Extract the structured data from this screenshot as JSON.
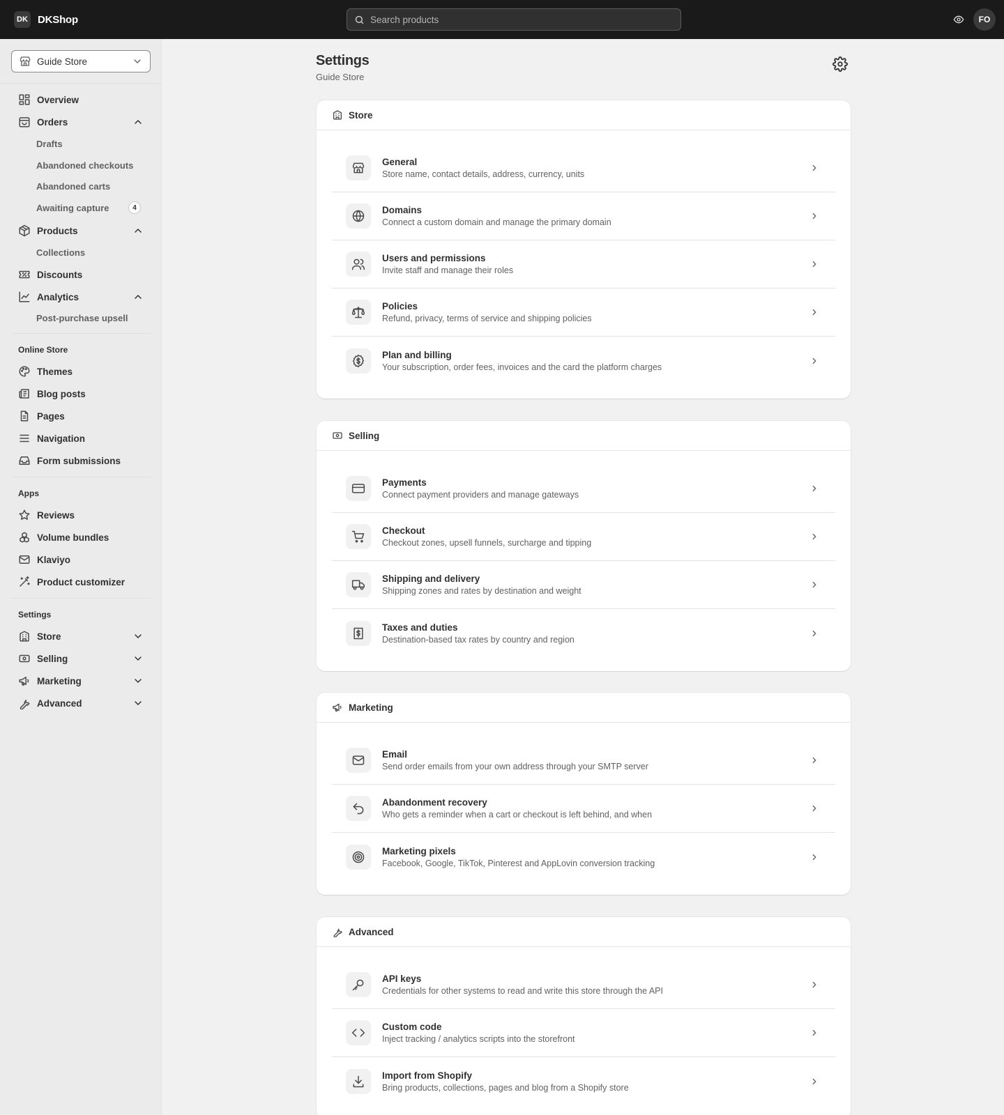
{
  "app": {
    "badge": "DK",
    "name": "DKShop"
  },
  "search": {
    "placeholder": "Search products"
  },
  "user": {
    "initials": "FO"
  },
  "sidebar": {
    "store_selector": "Guide Store",
    "main_nav": [
      {
        "label": "Overview",
        "icon": "overview-grid-icon"
      },
      {
        "label": "Orders",
        "icon": "orders-bag-icon",
        "expanded": true
      },
      {
        "label": "Drafts"
      },
      {
        "label": "Abandoned checkouts"
      },
      {
        "label": "Abandoned carts"
      },
      {
        "label": "Awaiting capture",
        "badge": "4"
      },
      {
        "label": "Products",
        "icon": "products-box-icon",
        "expanded": true
      },
      {
        "label": "Collections"
      },
      {
        "label": "Discounts",
        "icon": "discount-ticket-icon"
      },
      {
        "label": "Analytics",
        "icon": "analytics-chart-icon",
        "expanded": true
      },
      {
        "label": "Post-purchase upsell"
      }
    ],
    "online_store": {
      "heading": "Online Store",
      "items": [
        {
          "label": "Themes",
          "icon": "palette-icon"
        },
        {
          "label": "Blog posts",
          "icon": "newspaper-icon"
        },
        {
          "label": "Pages",
          "icon": "page-icon"
        },
        {
          "label": "Navigation",
          "icon": "menu-lines-icon"
        },
        {
          "label": "Form submissions",
          "icon": "inbox-icon"
        }
      ]
    },
    "apps": {
      "heading": "Apps",
      "items": [
        {
          "label": "Reviews",
          "icon": "star-icon"
        },
        {
          "label": "Volume bundles",
          "icon": "bundles-icon"
        },
        {
          "label": "Klaviyo",
          "icon": "mail-icon"
        },
        {
          "label": "Product customizer",
          "icon": "magic-wand-icon"
        }
      ]
    },
    "settings": {
      "heading": "Settings",
      "items": [
        {
          "label": "Store",
          "icon": "building-icon"
        },
        {
          "label": "Selling",
          "icon": "banknote-icon"
        },
        {
          "label": "Marketing",
          "icon": "megaphone-icon"
        },
        {
          "label": "Advanced",
          "icon": "wrench-icon"
        }
      ]
    }
  },
  "page": {
    "title": "Settings",
    "subtitle": "Guide Store"
  },
  "sections": [
    {
      "title": "Store",
      "icon": "building-icon",
      "rows": [
        {
          "title": "General",
          "desc": "Store name, contact details, address, currency, units",
          "icon": "storefront-icon"
        },
        {
          "title": "Domains",
          "desc": "Connect a custom domain and manage the primary domain",
          "icon": "globe-icon"
        },
        {
          "title": "Users and permissions",
          "desc": "Invite staff and manage their roles",
          "icon": "users-icon"
        },
        {
          "title": "Policies",
          "desc": "Refund, privacy, terms of service and shipping policies",
          "icon": "scale-icon"
        },
        {
          "title": "Plan and billing",
          "desc": "Your subscription, order fees, invoices and the card the platform charges",
          "icon": "dollar-circle-icon"
        }
      ]
    },
    {
      "title": "Selling",
      "icon": "banknote-icon",
      "rows": [
        {
          "title": "Payments",
          "desc": "Connect payment providers and manage gateways",
          "icon": "credit-card-icon"
        },
        {
          "title": "Checkout",
          "desc": "Checkout zones, upsell funnels, surcharge and tipping",
          "icon": "cart-icon"
        },
        {
          "title": "Shipping and delivery",
          "desc": "Shipping zones and rates by destination and weight",
          "icon": "truck-icon"
        },
        {
          "title": "Taxes and duties",
          "desc": "Destination-based tax rates by country and region",
          "icon": "receipt-icon"
        }
      ]
    },
    {
      "title": "Marketing",
      "icon": "megaphone-icon",
      "rows": [
        {
          "title": "Email",
          "desc": "Send order emails from your own address through your SMTP server",
          "icon": "mail-icon"
        },
        {
          "title": "Abandonment recovery",
          "desc": "Who gets a reminder when a cart or checkout is left behind, and when",
          "icon": "undo-icon"
        },
        {
          "title": "Marketing pixels",
          "desc": "Facebook, Google, TikTok, Pinterest and AppLovin conversion tracking",
          "icon": "target-icon"
        }
      ]
    },
    {
      "title": "Advanced",
      "icon": "wrench-icon",
      "rows": [
        {
          "title": "API keys",
          "desc": "Credentials for other systems to read and write this store through the API",
          "icon": "key-icon"
        },
        {
          "title": "Custom code",
          "desc": "Inject tracking / analytics scripts into the storefront",
          "icon": "code-icon"
        },
        {
          "title": "Import from Shopify",
          "desc": "Bring products, collections, pages and blog from a Shopify store",
          "icon": "download-icon"
        }
      ]
    }
  ]
}
